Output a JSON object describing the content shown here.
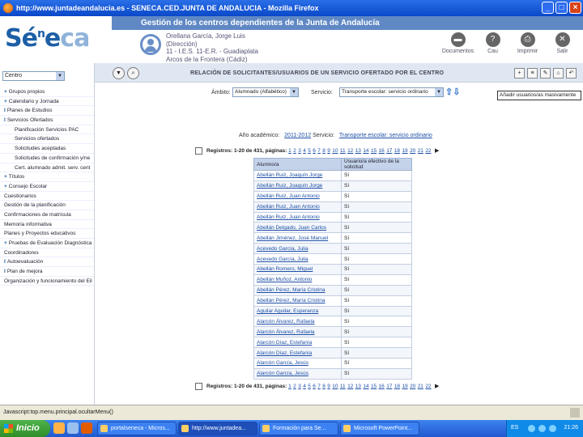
{
  "window": {
    "title": "http://www.juntadeandalucia.es - SENECA.CED.JUNTA DE ANDALUCIA - Mozilla Firefox",
    "controls": [
      "_",
      "□",
      "×"
    ]
  },
  "header": {
    "logo": {
      "prefix": "Sé",
      "sup": "n",
      "suffix_a": "e",
      "suffix_b": "ca"
    },
    "app_title": "Gestión de los centros dependientes de la Junta de Andalucía",
    "user": {
      "line1": "Orellana García, Jorge Luis",
      "line2": "(Dirección)",
      "line3": "11 - I.E.S. 11-E.R. - Guadiaplata",
      "line4": "Arcos de la Frontera (Cádiz)"
    },
    "tools": [
      {
        "label": "Documentos",
        "glyph": "▬"
      },
      {
        "label": "Cau",
        "glyph": "?"
      },
      {
        "label": "Imprimir",
        "glyph": "⎙"
      },
      {
        "label": "Salir",
        "glyph": "✕"
      }
    ]
  },
  "sidebar": {
    "selector": "Centro",
    "items": [
      {
        "mark": "+",
        "label": "Grupos propios"
      },
      {
        "mark": "+",
        "label": "Calendario y Jornada"
      },
      {
        "mark": "I",
        "label": "Planes de Estudios"
      },
      {
        "mark": "I",
        "label": "Servicios Ofertados"
      },
      {
        "mark": "",
        "label": "Planificación Servicios PAC",
        "indent": true
      },
      {
        "mark": "",
        "label": "Servicios ofertados",
        "indent": true
      },
      {
        "mark": "",
        "label": "Solicitudes aceptadas",
        "indent": true
      },
      {
        "mark": "",
        "label": "Solicitudes de confirmación y/ne",
        "indent": true
      },
      {
        "mark": "",
        "label": "Cert. alumnado admit. serv. cent",
        "indent": true
      },
      {
        "mark": "+",
        "label": "Títulos"
      },
      {
        "mark": "+",
        "label": "Consejo Escolar"
      },
      {
        "mark": "",
        "label": "Cuestionarios"
      },
      {
        "mark": "",
        "label": "Gestión de la planificación"
      },
      {
        "mark": "",
        "label": "Confirmaciones de matrícula"
      },
      {
        "mark": "",
        "label": "Memoria informativa"
      },
      {
        "mark": "",
        "label": "Planes y Proyectos educativos"
      },
      {
        "mark": "+",
        "label": "Pruebas de Evaluación Diagnóstica"
      },
      {
        "mark": "",
        "label": "Coordinadores"
      },
      {
        "mark": "I",
        "label": "Autoevaluación"
      },
      {
        "mark": "I",
        "label": "Plan de mejora"
      },
      {
        "mark": "",
        "label": "Organización y funcionamiento del Eil"
      }
    ]
  },
  "main": {
    "nav_title": "RELACIÓN DE SOLICITANTES/USUARIOS DE UN SERVICIO OFERTADO POR EL CENTRO",
    "filters": {
      "ambito_label": "Ámbito:",
      "ambito_value": "Alumnado (Alfabético)",
      "servicio_label": "Servicio:",
      "servicio_value": "Transporte escolar: servicio ordinario"
    },
    "tooltip": "Añadir usuarios/as masivamente",
    "context": {
      "year_label": "Año académico:",
      "year_value": "2011-2012",
      "service_label": "Servicio:",
      "service_value": "Transporte escolar: servicio ordinario"
    },
    "pager": {
      "text": "Registros: 1-20 de 431, páginas:",
      "pages": [
        "1",
        "2",
        "3",
        "4",
        "5",
        "6",
        "7",
        "8",
        "9",
        "10",
        "11",
        "12",
        "13",
        "14",
        "15",
        "16",
        "17",
        "18",
        "19",
        "20",
        "21",
        "22"
      ]
    },
    "table": {
      "columns": [
        "Alumno/a",
        "Usuario/a efectivo de la solicitud"
      ],
      "rows": [
        [
          "Abellán Ruiz, Joaquín Jorge",
          "Sí"
        ],
        [
          "Abellán Ruiz, Joaquín Jorge",
          "Sí"
        ],
        [
          "Abellán Ruiz, Juan Antonio",
          "Sí"
        ],
        [
          "Abellán Ruiz, Juan Antonio",
          "Sí"
        ],
        [
          "Abellán Ruiz, Juan Antonio",
          "Sí"
        ],
        [
          "Abellán Delgado, Juan Carlos",
          "Sí"
        ],
        [
          "Abellán Jiménez, José Manuel",
          "Sí"
        ],
        [
          "Acevedo García, Julia",
          "Sí"
        ],
        [
          "Acevedo García, Julia",
          "Sí"
        ],
        [
          "Abellán Romero, Miguel",
          "Sí"
        ],
        [
          "Abellán Muñoz, Antonio",
          "Sí"
        ],
        [
          "Abellán Pérez, María Cristina",
          "Sí"
        ],
        [
          "Abellán Pérez, María Cristina",
          "Sí"
        ],
        [
          "Aguilar Aguilar, Esperanza",
          "Sí"
        ],
        [
          "Alarcón Álvarez, Rafaela",
          "Sí"
        ],
        [
          "Alarcón Álvarez, Rafaela",
          "Sí"
        ],
        [
          "Alarcón Díaz, Estefanía",
          "Sí"
        ],
        [
          "Alarcón Díaz, Estefanía",
          "Sí"
        ],
        [
          "Alarcón García, Jesús",
          "Sí"
        ],
        [
          "Alarcón García, Jesús",
          "Sí"
        ]
      ]
    }
  },
  "statusbar": {
    "text": "Javascript:top.menu.principal.ocultarMenu()"
  },
  "taskbar": {
    "start": "Inicio",
    "tasks": [
      "portalseneca - Micros...",
      "http://www.juntadea...",
      "Formación para Se...",
      "Microsoft PowerPoint..."
    ],
    "lang": "ES",
    "clock": "21:26"
  },
  "colors": {
    "brand": "#1d5fa6",
    "titlebar": "#0a48c8",
    "header_band": "#5f88c4",
    "link": "#1d4fa6"
  }
}
